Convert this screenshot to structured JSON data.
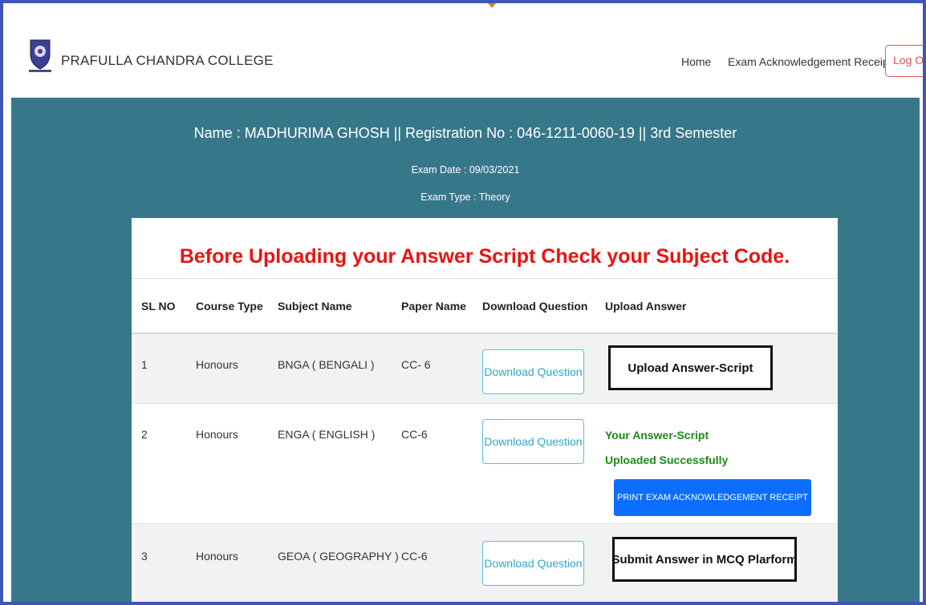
{
  "navbar": {
    "brand": "PRAFULLA CHANDRA COLLEGE",
    "home": "Home",
    "receipt": "Exam Acknowledgement Receipt",
    "logout": "Log Out"
  },
  "student": {
    "line": "Name : MADHURIMA GHOSH || Registration No : 046-1211-0060-19 || 3rd Semester",
    "exam_date": "Exam Date : 09/03/2021",
    "exam_type": "Exam Type : Theory"
  },
  "warning": "Before Uploading your Answer Script Check your Subject Code.",
  "table": {
    "headers": [
      "SL NO",
      "Course Type",
      "Subject Name",
      "Paper Name",
      "Download Question",
      "Upload Answer"
    ],
    "rows": [
      {
        "sl": "1",
        "course": "Honours",
        "subject": "BNGA ( BENGALI )",
        "paper": "CC- 6",
        "download": "Download Question",
        "upload": "Upload Answer-Script"
      },
      {
        "sl": "2",
        "course": "Honours",
        "subject": "ENGA ( ENGLISH )",
        "paper": "CC-6",
        "download": "Download Question",
        "success_line1": "Your Answer-Script",
        "success_line2": "Uploaded Successfully",
        "print": "PRINT EXAM ACKNOWLEDGEMENT RECEIPT"
      },
      {
        "sl": "3",
        "course": "Honours",
        "subject": "GEOA ( GEOGRAPHY )",
        "paper": "CC-6",
        "download": "Download Question",
        "upload": "Submit Answer in MCQ Plarform"
      }
    ]
  },
  "colors": {
    "banner": "#37778a",
    "warning": "#ee1111",
    "success": "#1a8a1a",
    "primary": "#0d6efd",
    "info": "#5bc0de",
    "frame": "#3f56b8"
  }
}
